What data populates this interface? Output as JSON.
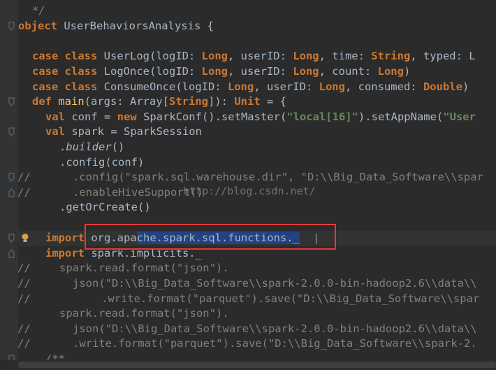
{
  "lines": {
    "l0": "*/",
    "l1_kw": "object",
    "l1_name": " UserBehaviorsAnalysis {",
    "l3": {
      "kw1": "case",
      "kw2": "class",
      "name": " UserLog(logID: ",
      "t1": "Long",
      "p1": ", userID: ",
      "t2": "Long",
      "p2": ", time: ",
      "t3": "String",
      "p3": ", typed: L"
    },
    "l4": {
      "kw1": "case",
      "kw2": "class",
      "name": " LogOnce(logID: ",
      "t1": "Long",
      "p1": ", userID: ",
      "t2": "Long",
      "p2": ", count: ",
      "t3": "Long",
      "p3": ")"
    },
    "l5": {
      "kw1": "case",
      "kw2": "class",
      "name": " ConsumeOnce(logID: ",
      "t1": "Long",
      "p1": ", userID: ",
      "t2": "Long",
      "p2": ", consumed: ",
      "t3": "Double",
      "p3": ")"
    },
    "l6": {
      "kw": "def",
      "fn": "main",
      "a": "(args: Array[",
      "t": "String",
      "b": "]): ",
      "u": "Unit",
      "c": " = {"
    },
    "l7": {
      "kw1": "val",
      "a": " conf = ",
      "kw2": "new",
      "b": " SparkConf().setMaster(",
      "s1": "\"local[16]\"",
      "c": ").setAppName(",
      "s2": "\"User"
    },
    "l8": {
      "kw": "val",
      "a": " spark = SparkSession"
    },
    "l9": {
      "dot": ".",
      "it": "builder",
      "rest": "()"
    },
    "l10": ".config(conf)",
    "l11": {
      "cm": "//",
      "txt": ".config(\"spark.sql.warehouse.dir\", \"D:\\\\Big_Data_Software\\\\spar"
    },
    "l12": {
      "cm": "//",
      "txt": ".enableHiveSupport()"
    },
    "l13": ".getOrCreate()",
    "l15": {
      "kw": "import",
      "pre": " org.apa",
      "sel": "che.spark.sql.functions._"
    },
    "l16": {
      "kw": "import",
      "rest": " spark.implicits._"
    },
    "l17": {
      "cm": "//",
      "txt": "spark.read.format(\"json\")."
    },
    "l18": {
      "cm": "//",
      "txt": "json(\"D:\\\\Big_Data_Software\\\\spark-2.0.0-bin-hadoop2.6\\\\data\\\\"
    },
    "l19": {
      "cm": "//",
      "txt": ".write.format(\"parquet\").save(\"D:\\\\Big_Data_Software\\\\spar"
    },
    "l20": "spark.read.format(\"json\").",
    "l21": {
      "cm": "//",
      "txt": "json(\"D:\\\\Big_Data_Software\\\\spark-2.0.0-bin-hadoop2.6\\\\data\\\\"
    },
    "l22": {
      "cm": "//",
      "txt": ".write.format(\"parquet\").save(\"D:\\\\Big_Data_Software\\\\spark-2."
    },
    "l23": "/**"
  },
  "watermark": "http://blog.csdn.net/",
  "colors": {
    "background": "#2b2b2b",
    "keyword": "#cc7832",
    "string": "#6a8759",
    "comment": "#808080",
    "selection": "#214283",
    "highlight_box": "#e03b3b"
  }
}
